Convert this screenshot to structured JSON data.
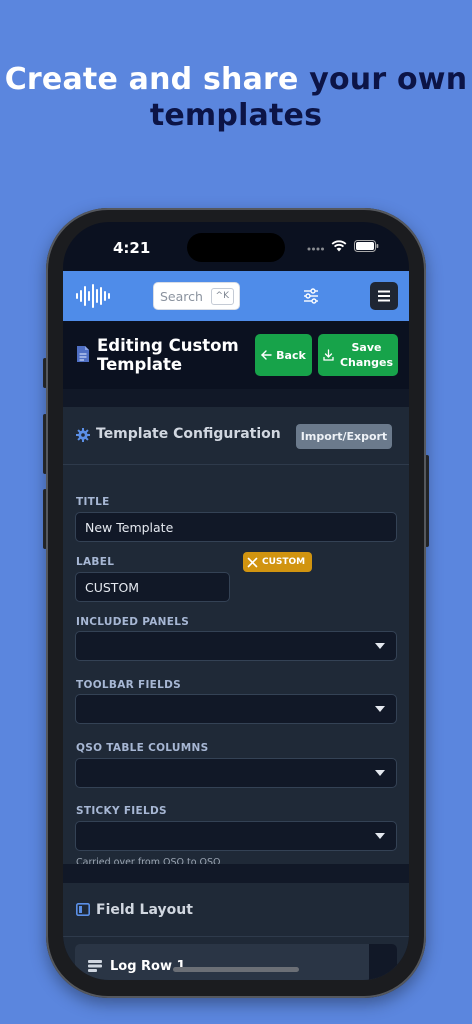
{
  "headline": {
    "part1": "Create and share ",
    "part2": "your own",
    "part3": "templates"
  },
  "status": {
    "time": "4:21"
  },
  "header": {
    "search_placeholder": "Search",
    "search_shortcut": "^K"
  },
  "page": {
    "title": "Editing Custom Template",
    "back_label": "Back",
    "save_label_line1": "Save",
    "save_label_line2": "Changes"
  },
  "config": {
    "title": "Template Configuration",
    "import_export": "Import/Export",
    "title_label": "TITLE",
    "title_value": "New Template",
    "label_label": "LABEL",
    "label_value": "CUSTOM",
    "badge": "CUSTOM",
    "included_panels_label": "INCLUDED PANELS",
    "toolbar_fields_label": "TOOLBAR FIELDS",
    "qso_columns_label": "QSO TABLE COLUMNS",
    "sticky_fields_label": "STICKY FIELDS",
    "sticky_help": "Carried over from QSO to QSO"
  },
  "layout": {
    "title": "Field Layout",
    "row_title": "Log Row 1"
  },
  "colors": {
    "background": "#5b86de",
    "app_header": "#4f8ce9",
    "green": "#17a34a",
    "badge": "#d19410",
    "accent_headline": "#0c1446"
  }
}
